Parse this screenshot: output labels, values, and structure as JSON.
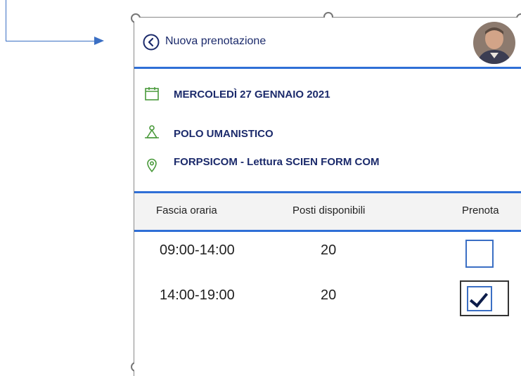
{
  "header": {
    "title": "Nuova prenotazione"
  },
  "info": {
    "date": "MERCOLEDÌ 27 GENNAIO 2021",
    "location": "POLO UMANISTICO",
    "room": "FORPSICOM - Lettura SCIEN FORM COM"
  },
  "table": {
    "columns": [
      "Fascia oraria",
      "Posti disponibili",
      "Prenota"
    ],
    "rows": [
      {
        "time": "09:00-14:00",
        "seats": "20",
        "booked": false
      },
      {
        "time": "14:00-19:00",
        "seats": "20",
        "booked": true
      }
    ]
  },
  "colors": {
    "accent": "#2f6fd6",
    "text_primary": "#1b2a6b",
    "icon_green": "#4a9a3c"
  },
  "icons": {
    "back": "back-circle-icon",
    "date": "calendar-icon",
    "location": "building-icon",
    "room": "map-pin-icon"
  }
}
